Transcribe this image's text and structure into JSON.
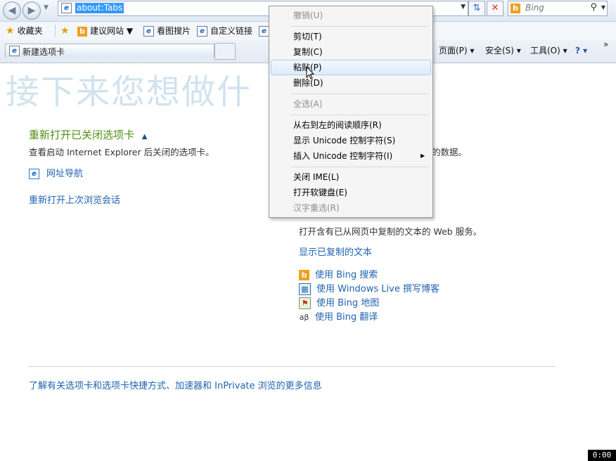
{
  "address_bar": {
    "url": "about:Tabs"
  },
  "search_box": {
    "placeholder": "Bing"
  },
  "favorites_bar": {
    "favorites_label": "收藏夹",
    "items": [
      "建议网站 ▼",
      "看图搜片",
      "自定义链接"
    ]
  },
  "tab": {
    "title": "新建选项卡"
  },
  "command_bar": {
    "page": "页面(P) ▾",
    "safety": "安全(S) ▾",
    "tools": "工具(O) ▾",
    "help": "? ▾",
    "more": "»"
  },
  "page": {
    "title": "接下来您想做什",
    "reopen_heading": "重新打开已关闭选项卡",
    "reopen_desc": "查看启动 Internet Explorer 后关闭的选项卡。",
    "site_nav_link": "网址导航",
    "reopen_session_link": "重新打开上次浏览会话",
    "right_desc_tail": "的数据。",
    "copied_desc": "打开含有已从网页中复制的文本的 Web 服务。",
    "show_copied_link": "显示已复制的文本",
    "accelerators": [
      "使用 Bing 搜索",
      "使用 Windows Live 撰写博客",
      "使用 Bing 地图",
      "使用 Bing 翻译"
    ],
    "footer_link": "了解有关选项卡和选项卡快捷方式、加速器和 InPrivate 浏览的更多信息"
  },
  "context_menu": {
    "undo": "撤销(U)",
    "cut": "剪切(T)",
    "copy": "复制(C)",
    "paste": "粘贴(P)",
    "delete": "删除(D)",
    "select_all": "全选(A)",
    "rtl": "从右到左的阅读顺序(R)",
    "show_unicode": "显示 Unicode 控制字符(S)",
    "insert_unicode": "插入 Unicode 控制字符(I)",
    "close_ime": "关闭 IME(L)",
    "soft_keyboard": "打开软键盘(E)",
    "reconvert": "汉字重选(R)"
  },
  "clock": "0:00",
  "colors": {
    "accent_green": "#4f8f16",
    "link_blue": "#1f63b0",
    "title_faint": "#d2e2ef"
  }
}
